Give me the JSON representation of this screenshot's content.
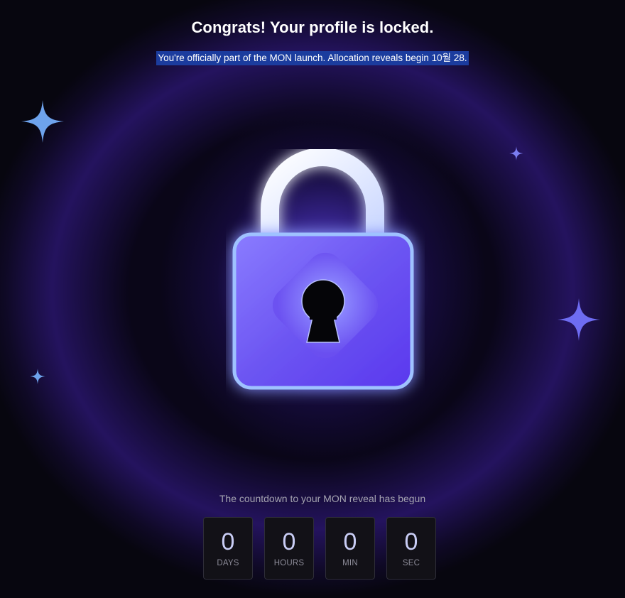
{
  "header": {
    "title": "Congrats! Your profile is locked.",
    "subtitle": "You're officially part of the MON launch. Allocation reveals begin 10월 28."
  },
  "illustration": {
    "icon": "padlock-icon",
    "colors": {
      "lock_body": "#6c55f2",
      "shackle": "#e6ecff",
      "keyhole": "#050508",
      "glow": "#7a5cff"
    }
  },
  "sparkles": [
    {
      "icon": "sparkle-icon",
      "color": "#6ea3ec"
    },
    {
      "icon": "sparkle-icon",
      "color": "#7b7cf0"
    },
    {
      "icon": "sparkle-icon",
      "color": "#6e6cf2"
    },
    {
      "icon": "sparkle-icon",
      "color": "#6ea3ec"
    }
  ],
  "countdown": {
    "label": "The countdown to your MON reveal has begun",
    "units": [
      {
        "value": "0",
        "label": "DAYS"
      },
      {
        "value": "0",
        "label": "HOURS"
      },
      {
        "value": "0",
        "label": "MIN"
      },
      {
        "value": "0",
        "label": "SEC"
      }
    ]
  },
  "colors": {
    "background": "#07060f",
    "highlight": "#1b3c9e",
    "timer_digits": "#c9cdf5"
  }
}
